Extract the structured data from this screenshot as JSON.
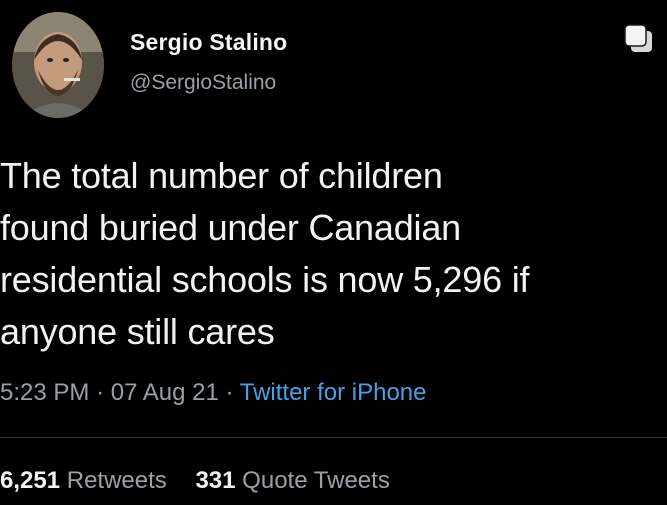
{
  "user": {
    "display_name": "Sergio Stalino",
    "handle": "@SergioStalino"
  },
  "tweet": {
    "lines": [
      "The total number of children",
      "found buried under Canadian",
      "residential schools is now 5,296 if",
      "anyone still cares"
    ],
    "time": "5:23 PM",
    "date": "07 Aug 21",
    "separator": "·",
    "source": "Twitter for iPhone"
  },
  "stats": {
    "retweets_count": "6,251",
    "retweets_label": "Retweets",
    "quotes_count": "331",
    "quotes_label": "Quote Tweets"
  },
  "icons": {
    "share": "share-icon"
  },
  "colors": {
    "background": "#000000",
    "text": "#f2f2f2",
    "secondary": "#9aa0a6",
    "link": "#4a9fe8"
  }
}
